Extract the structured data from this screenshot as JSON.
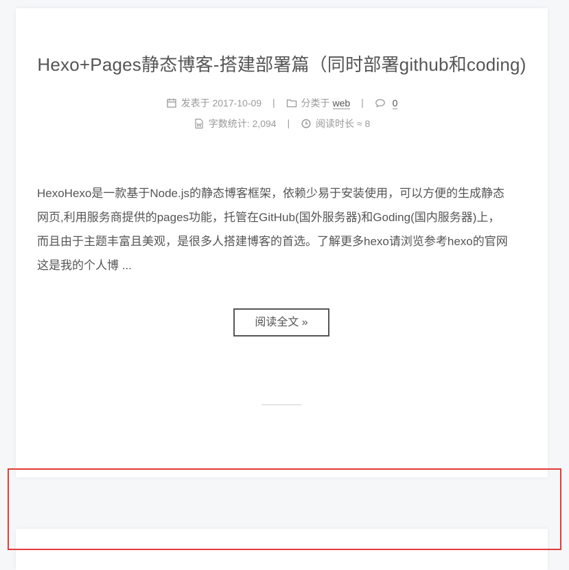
{
  "post": {
    "title": "Hexo+Pages静态博客-搭建部署篇（同时部署github和coding)",
    "meta": {
      "posted_label": "发表于",
      "posted_date": "2017-10-09",
      "category_label": "分类于",
      "category": "web",
      "comments_count": "0",
      "word_count_label": "字数统计:",
      "word_count": "2,094",
      "read_time_label": "阅读时长 ≈",
      "read_time": "8"
    },
    "excerpt_lines": [
      "HexoHexo是一款基于Node.js的静态博客框架，依赖少易于安装使用，可以方便的生成静态",
      "网页,利用服务商提供的pages功能，托管在GitHub(国外服务器)和Goding(国内服务器)上，",
      "而且由于主题丰富且美观，是很多人搭建博客的首选。了解更多hexo请浏览参考hexo的官网",
      "这是我的个人博 ..."
    ],
    "read_more_label": "阅读全文 »"
  },
  "icons": {
    "calendar": "calendar-icon",
    "folder": "folder-icon",
    "comment": "comment-icon",
    "word": "word-file-icon",
    "clock": "clock-icon"
  },
  "colors": {
    "page_bg": "#f5f7f9",
    "card_bg": "#ffffff",
    "text": "#555555",
    "meta_text": "#999999",
    "highlight": "#e53935"
  }
}
